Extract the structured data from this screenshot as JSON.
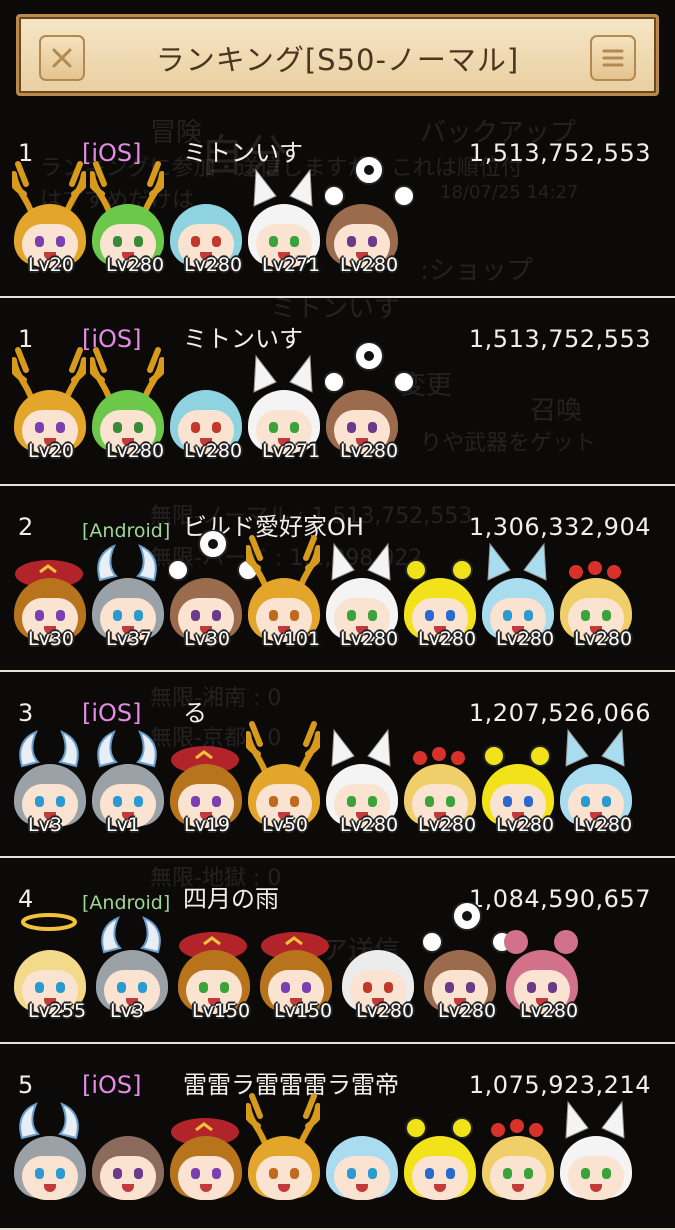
{
  "header": {
    "title": "ランキング[S50-ノーマル]",
    "close_icon": "close-icon",
    "menu_icon": "menu-icon"
  },
  "background_text": [
    "冒険",
    "自分",
    "バックアップ",
    "ランキングに参加・送信しますが、これは順位付",
    "はすすめだけは",
    "18/07/25 14:27",
    ":ショップ",
    "ミトンいす",
    "変更",
    "召喚",
    "りや武器をゲット",
    "無限-ノーマル : 1,513,752,553",
    "無限-ハード : 1,1,098,022",
    "無限-湘南 : 0",
    "無限-京都 : 0",
    "無限-地獄 : 0",
    "スコア送信"
  ],
  "rows": [
    {
      "rank": "1",
      "platform": "[iOS]",
      "platform_type": "ios",
      "name": "ミトンいす",
      "score": "1,513,752,553",
      "characters": [
        {
          "level": "Lv20",
          "hair": "#e3a52a",
          "eyes": "#7a3fb0",
          "accessory": "antlers"
        },
        {
          "level": "Lv280",
          "hair": "#6bc84a",
          "eyes": "#3a8a3a",
          "accessory": "antlers"
        },
        {
          "level": "Lv280",
          "hair": "#8fd3e0",
          "eyes": "#c0392b",
          "accessory": "none"
        },
        {
          "level": "Lv271",
          "hair": "#f4f4f4",
          "eyes": "#3aa33a",
          "accessory": "cat-ears"
        },
        {
          "level": "Lv280",
          "hair": "#9a6b4c",
          "eyes": "#6b3b8a",
          "accessory": "orbs"
        }
      ]
    },
    {
      "rank": "1",
      "platform": "[iOS]",
      "platform_type": "ios",
      "name": "ミトンいす",
      "score": "1,513,752,553",
      "characters": [
        {
          "level": "Lv20",
          "hair": "#e3a52a",
          "eyes": "#7a3fb0",
          "accessory": "antlers"
        },
        {
          "level": "Lv280",
          "hair": "#6bc84a",
          "eyes": "#3a8a3a",
          "accessory": "antlers"
        },
        {
          "level": "Lv280",
          "hair": "#8fd3e0",
          "eyes": "#c0392b",
          "accessory": "none"
        },
        {
          "level": "Lv271",
          "hair": "#f4f4f4",
          "eyes": "#3aa33a",
          "accessory": "cat-ears"
        },
        {
          "level": "Lv280",
          "hair": "#9a6b4c",
          "eyes": "#6b3b8a",
          "accessory": "orbs"
        }
      ]
    },
    {
      "rank": "2",
      "platform": "[Android]",
      "platform_type": "android",
      "name": "ビルド愛好家OH",
      "score": "1,306,332,904",
      "characters": [
        {
          "level": "Lv30",
          "hair": "#b8741c",
          "eyes": "#7a3fb0",
          "accessory": "beret"
        },
        {
          "level": "Lv37",
          "hair": "#9aa2a8",
          "eyes": "#2a9ad0",
          "accessory": "wings"
        },
        {
          "level": "Lv30",
          "hair": "#9a6b4c",
          "eyes": "#6b3b8a",
          "accessory": "orbs"
        },
        {
          "level": "Lv101",
          "hair": "#e3a52a",
          "eyes": "#c06a20",
          "accessory": "antlers"
        },
        {
          "level": "Lv280",
          "hair": "#f4f4f4",
          "eyes": "#3aa33a",
          "accessory": "cat-ears"
        },
        {
          "level": "Lv280",
          "hair": "#f2e21a",
          "eyes": "#2a6ad0",
          "accessory": "tiger"
        },
        {
          "level": "Lv280",
          "hair": "#a9dcef",
          "eyes": "#2a9ad0",
          "accessory": "cat-ears"
        },
        {
          "level": "Lv280",
          "hair": "#f0cf6a",
          "eyes": "#3aa33a",
          "accessory": "flowers"
        }
      ]
    },
    {
      "rank": "3",
      "platform": "[iOS]",
      "platform_type": "ios",
      "name": "る",
      "score": "1,207,526,066",
      "characters": [
        {
          "level": "Lv3",
          "hair": "#9aa2a8",
          "eyes": "#2a9ad0",
          "accessory": "wings"
        },
        {
          "level": "Lv1",
          "hair": "#9aa2a8",
          "eyes": "#2a9ad0",
          "accessory": "wings"
        },
        {
          "level": "Lv19",
          "hair": "#b8741c",
          "eyes": "#7a3fb0",
          "accessory": "beret"
        },
        {
          "level": "Lv50",
          "hair": "#e3a52a",
          "eyes": "#c06a20",
          "accessory": "antlers"
        },
        {
          "level": "Lv280",
          "hair": "#f4f4f4",
          "eyes": "#3aa33a",
          "accessory": "cat-ears"
        },
        {
          "level": "Lv280",
          "hair": "#f0cf6a",
          "eyes": "#3aa33a",
          "accessory": "flowers"
        },
        {
          "level": "Lv280",
          "hair": "#f2e21a",
          "eyes": "#2a6ad0",
          "accessory": "tiger"
        },
        {
          "level": "Lv280",
          "hair": "#a9dcef",
          "eyes": "#2a9ad0",
          "accessory": "cat-ears"
        }
      ]
    },
    {
      "rank": "4",
      "platform": "[Android]",
      "platform_type": "android",
      "name": "四月の雨",
      "score": "1,084,590,657",
      "characters": [
        {
          "level": "Lv255",
          "hair": "#f3d98a",
          "eyes": "#2a9ad0",
          "accessory": "halo"
        },
        {
          "level": "Lv3",
          "hair": "#9aa2a8",
          "eyes": "#2a9ad0",
          "accessory": "wings"
        },
        {
          "level": "Lv150",
          "hair": "#b8741c",
          "eyes": "#3aa33a",
          "accessory": "beret"
        },
        {
          "level": "Lv150",
          "hair": "#b8741c",
          "eyes": "#7a3fb0",
          "accessory": "beret"
        },
        {
          "level": "Lv280",
          "hair": "#ececec",
          "eyes": "#c0392b",
          "accessory": "none"
        },
        {
          "level": "Lv280",
          "hair": "#9a6b4c",
          "eyes": "#6b3b8a",
          "accessory": "orbs"
        },
        {
          "level": "Lv280",
          "hair": "#d2728a",
          "eyes": "#6b3b8a",
          "accessory": "buns"
        }
      ]
    },
    {
      "rank": "5",
      "platform": "[iOS]",
      "platform_type": "ios",
      "name": "雷雷ラ雷雷雷ラ雷帝",
      "score": "1,075,923,214",
      "characters": [
        {
          "level": "",
          "hair": "#9aa2a8",
          "eyes": "#2a9ad0",
          "accessory": "wings"
        },
        {
          "level": "",
          "hair": "#8a6b5c",
          "eyes": "#6b3b8a",
          "accessory": "none"
        },
        {
          "level": "",
          "hair": "#b8741c",
          "eyes": "#7a3fb0",
          "accessory": "beret"
        },
        {
          "level": "",
          "hair": "#e3a52a",
          "eyes": "#c06a20",
          "accessory": "antlers"
        },
        {
          "level": "",
          "hair": "#a9dcef",
          "eyes": "#2a9ad0",
          "accessory": "none"
        },
        {
          "level": "",
          "hair": "#f2e21a",
          "eyes": "#2a6ad0",
          "accessory": "tiger"
        },
        {
          "level": "",
          "hair": "#f0cf6a",
          "eyes": "#3aa33a",
          "accessory": "flowers"
        },
        {
          "level": "",
          "hair": "#f4f4f4",
          "eyes": "#3aa33a",
          "accessory": "cat-ears"
        }
      ]
    }
  ]
}
